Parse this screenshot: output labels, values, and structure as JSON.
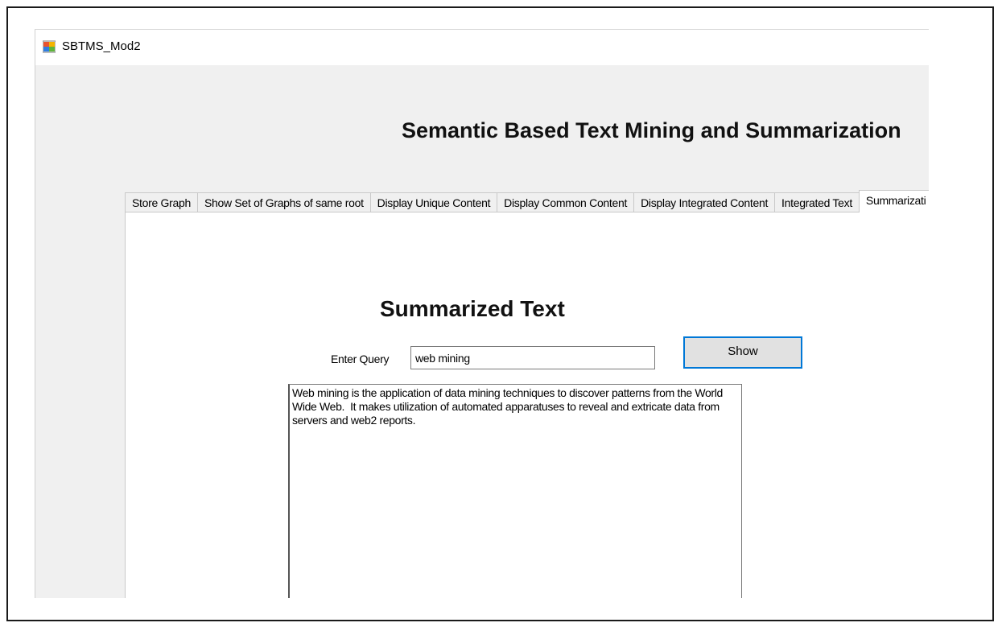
{
  "window": {
    "title": "SBTMS_Mod2",
    "icon": "windows-forms-app-icon"
  },
  "header": {
    "title": "Semantic Based Text Mining and Summarization"
  },
  "tabs": [
    {
      "label": "Store Graph",
      "active": false
    },
    {
      "label": "Show Set of Graphs of same root",
      "active": false
    },
    {
      "label": "Display Unique Content",
      "active": false
    },
    {
      "label": "Display Common Content",
      "active": false
    },
    {
      "label": "Display Integrated Content",
      "active": false
    },
    {
      "label": "Integrated Text",
      "active": false
    },
    {
      "label": "Summarizati",
      "active": true
    }
  ],
  "summary_tab": {
    "heading": "Summarized Text",
    "query_label": "Enter Query",
    "query_value": "web mining",
    "show_button": "Show",
    "result_text": "Web mining is the application of data mining techniques to discover patterns from the World Wide Web.  It makes utilization of automated apparatuses to reveal and extricate data from servers and web2 reports."
  },
  "colors": {
    "focus_border": "#0078d7",
    "form_background": "#f0f0f0"
  }
}
